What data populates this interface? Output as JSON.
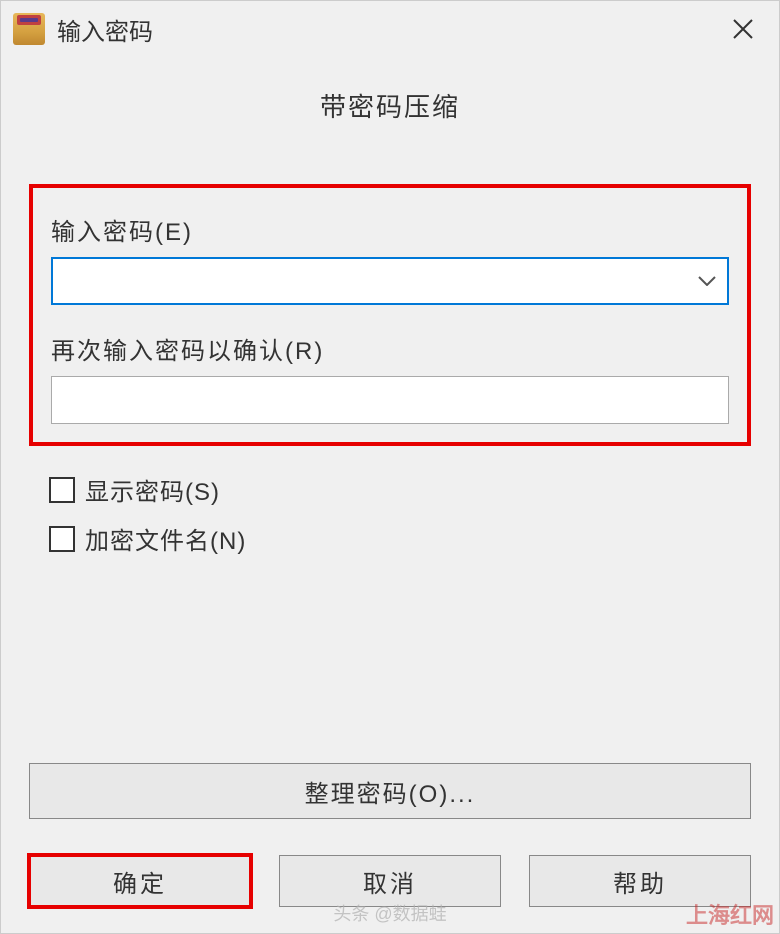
{
  "titlebar": {
    "title": "输入密码"
  },
  "heading": "带密码压缩",
  "fields": {
    "password_label": "输入密码(E)",
    "password_value": "",
    "confirm_label": "再次输入密码以确认(R)",
    "confirm_value": ""
  },
  "checkboxes": {
    "show_password_label": "显示密码(S)",
    "show_password_checked": false,
    "encrypt_filenames_label": "加密文件名(N)",
    "encrypt_filenames_checked": false
  },
  "buttons": {
    "organize": "整理密码(O)...",
    "ok": "确定",
    "cancel": "取消",
    "help": "帮助"
  },
  "watermarks": {
    "left": "头条 @数据蛙",
    "right": "上海红网"
  }
}
